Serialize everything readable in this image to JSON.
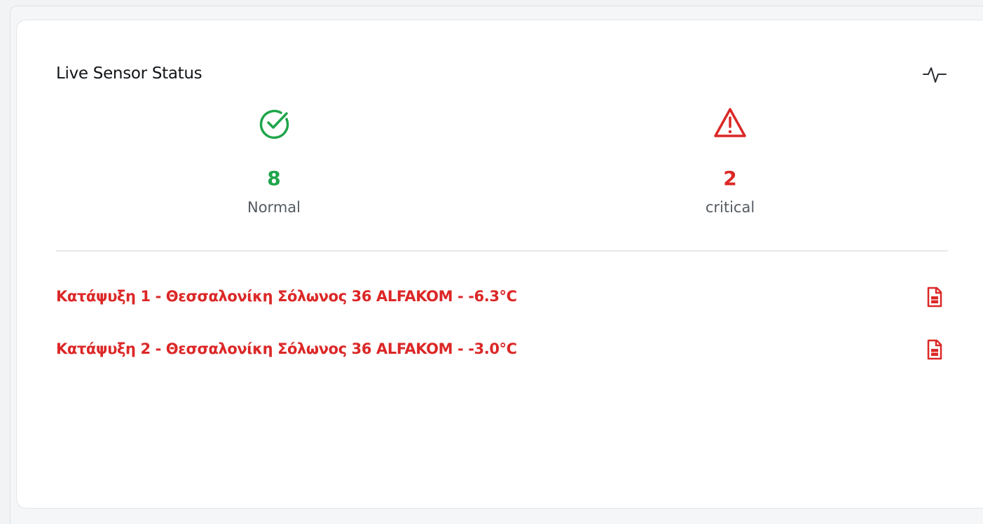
{
  "card": {
    "title": "Live Sensor Status",
    "header_icon": "activity-icon"
  },
  "stats": {
    "normal": {
      "icon": "check-circle-icon",
      "count": "8",
      "label": "Normal",
      "color": "#1ea54a"
    },
    "critical": {
      "icon": "alert-triangle-icon",
      "count": "2",
      "label": "critical",
      "color": "#dc2727"
    }
  },
  "alerts": [
    {
      "text": "Κατάψυξη 1 - Θεσσαλονίκη Σόλωνος 36 ALFAKOM - -6.3°C",
      "icon": "file-report-icon"
    },
    {
      "text": "Κατάψυξη 2 - Θεσσαλονίκη Σόλωνος 36 ALFAKOM - -3.0°C",
      "icon": "file-report-icon"
    }
  ],
  "colors": {
    "alert": "#dc2727",
    "normal": "#1ea54a"
  }
}
